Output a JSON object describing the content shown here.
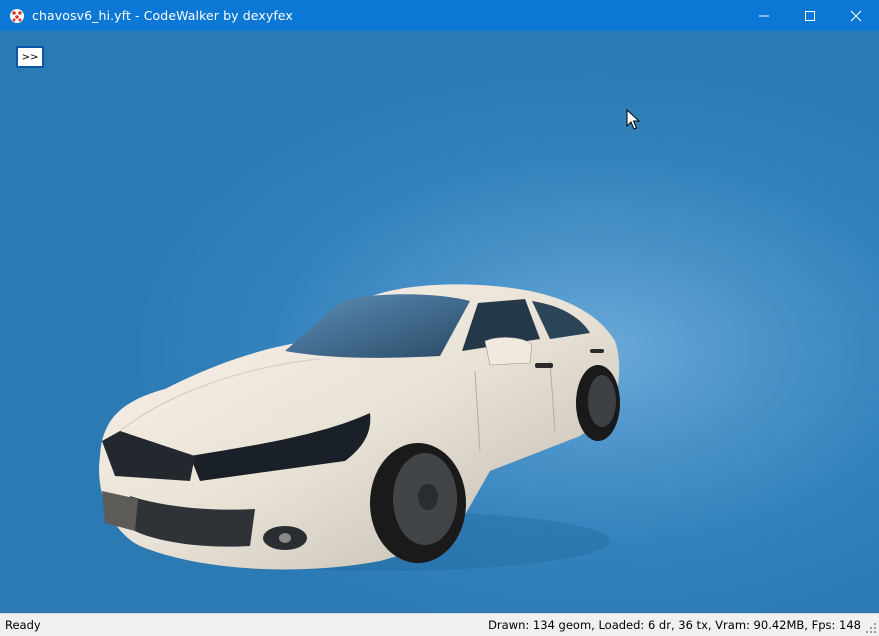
{
  "window": {
    "title": "chavosv6_hi.yft - CodeWalker by dexyfex"
  },
  "toolbar": {
    "toggle_label": ">>"
  },
  "statusbar": {
    "left": "Ready",
    "right": "Drawn: 134 geom, Loaded: 6 dr, 36 tx, Vram: 90.42MB, Fps: 148"
  },
  "colors": {
    "titlebar": "#0a78d4",
    "viewport_bg": "#2d7fb9",
    "car_body": "#ece6dc"
  }
}
